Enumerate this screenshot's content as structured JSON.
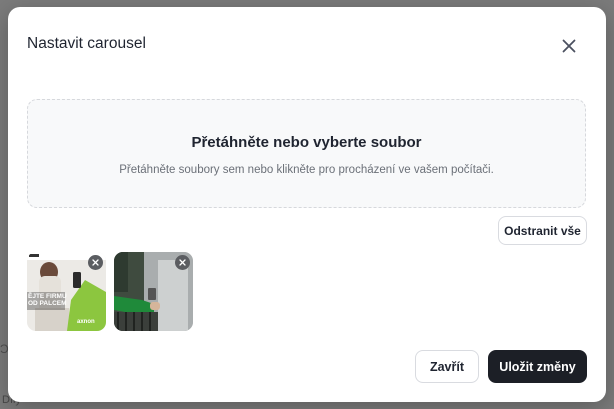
{
  "dialog": {
    "title": "Nastavit carousel",
    "close_icon": "close-icon"
  },
  "dropzone": {
    "title": "Přetáhněte nebo vyberte soubor",
    "subtitle": "Přetáhněte soubory sem nebo klikněte pro procházení ve vašem počítači."
  },
  "actions": {
    "remove_all_label": "Odstranit vše",
    "close_label": "Zavřít",
    "save_label": "Uložit změny"
  },
  "thumbnails": [
    {
      "banner_line1": "ĚJTE FIRMU",
      "banner_line2": "OD PALCEM",
      "brand": "axnon",
      "remove_icon": "close-icon"
    },
    {
      "remove_icon": "close-icon"
    }
  ],
  "background": {
    "hint_text": "Díly"
  },
  "colors": {
    "primary_button": "#1c1f26",
    "overlay": "#7b7b7b",
    "accent_green": "#8cc63f"
  }
}
